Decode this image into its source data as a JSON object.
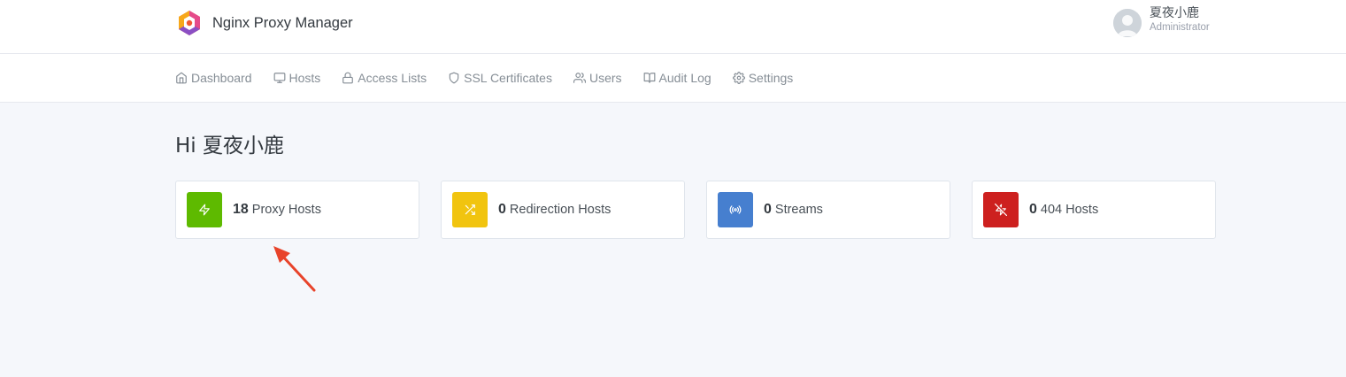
{
  "app": {
    "title": "Nginx Proxy Manager",
    "user_name": "夏夜小鹿",
    "user_role": "Administrator"
  },
  "nav": {
    "items": [
      {
        "label": "Dashboard",
        "icon": "home-icon"
      },
      {
        "label": "Hosts",
        "icon": "monitor-icon"
      },
      {
        "label": "Access Lists",
        "icon": "lock-icon"
      },
      {
        "label": "SSL Certificates",
        "icon": "shield-icon"
      },
      {
        "label": "Users",
        "icon": "users-icon"
      },
      {
        "label": "Audit Log",
        "icon": "book-open-icon"
      },
      {
        "label": "Settings",
        "icon": "settings-icon"
      }
    ]
  },
  "main": {
    "greeting": "Hi 夏夜小鹿",
    "cards": [
      {
        "count": "18",
        "label": "Proxy Hosts",
        "icon": "zap-icon",
        "color": "#5eba00"
      },
      {
        "count": "0",
        "label": "Redirection Hosts",
        "icon": "shuffle-icon",
        "color": "#f1c40f"
      },
      {
        "count": "0",
        "label": "Streams",
        "icon": "radio-icon",
        "color": "#467fcf"
      },
      {
        "count": "0",
        "label": "404 Hosts",
        "icon": "zap-off-icon",
        "color": "#cd201f"
      }
    ]
  },
  "annotation": {
    "color": "#e8432a"
  }
}
